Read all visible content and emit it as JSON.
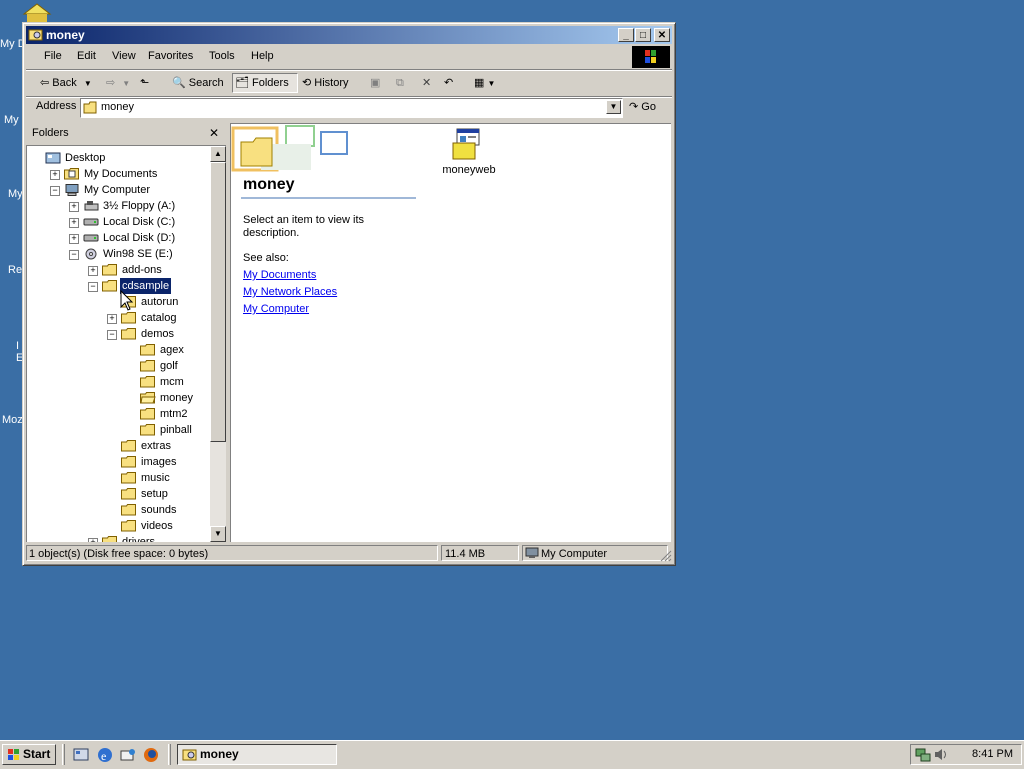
{
  "desktop": {
    "labels": [
      "My D",
      "My",
      "My",
      "Re",
      "I",
      "E",
      "Moz"
    ]
  },
  "window": {
    "title": "money",
    "controls": {
      "minimize": "_",
      "maximize": "□",
      "close": "✕"
    }
  },
  "menu": [
    "File",
    "Edit",
    "View",
    "Favorites",
    "Tools",
    "Help"
  ],
  "toolbar": {
    "back": "Back",
    "search": "Search",
    "folders": "Folders",
    "history": "History"
  },
  "address": {
    "label": "Address",
    "value": "money",
    "go": "Go"
  },
  "folders_pane": {
    "title": "Folders",
    "close": "✕",
    "tree": [
      {
        "label": "Desktop",
        "level": 0,
        "expander": "",
        "icon": "desktop-icon"
      },
      {
        "label": "My Documents",
        "level": 1,
        "expander": "+",
        "icon": "my-documents-icon"
      },
      {
        "label": "My Computer",
        "level": 1,
        "expander": "−",
        "icon": "my-computer-icon"
      },
      {
        "label": "3½ Floppy (A:)",
        "level": 2,
        "expander": "+",
        "icon": "floppy-icon"
      },
      {
        "label": "Local Disk (C:)",
        "level": 2,
        "expander": "+",
        "icon": "disk-icon"
      },
      {
        "label": "Local Disk (D:)",
        "level": 2,
        "expander": "+",
        "icon": "disk-icon"
      },
      {
        "label": "Win98 SE (E:)",
        "level": 2,
        "expander": "−",
        "icon": "cd-icon"
      },
      {
        "label": "add-ons",
        "level": 3,
        "expander": "+",
        "icon": "folder-icon"
      },
      {
        "label": "cdsample",
        "level": 3,
        "expander": "−",
        "icon": "folder-icon",
        "selected": true
      },
      {
        "label": "autorun",
        "level": 4,
        "expander": "",
        "icon": "folder-icon"
      },
      {
        "label": "catalog",
        "level": 4,
        "expander": "+",
        "icon": "folder-icon"
      },
      {
        "label": "demos",
        "level": 4,
        "expander": "−",
        "icon": "folder-icon"
      },
      {
        "label": "agex",
        "level": 5,
        "expander": "",
        "icon": "folder-icon"
      },
      {
        "label": "golf",
        "level": 5,
        "expander": "",
        "icon": "folder-icon"
      },
      {
        "label": "mcm",
        "level": 5,
        "expander": "",
        "icon": "folder-icon"
      },
      {
        "label": "money",
        "level": 5,
        "expander": "",
        "icon": "open-folder-icon"
      },
      {
        "label": "mtm2",
        "level": 5,
        "expander": "",
        "icon": "folder-icon"
      },
      {
        "label": "pinball",
        "level": 5,
        "expander": "",
        "icon": "folder-icon"
      },
      {
        "label": "extras",
        "level": 4,
        "expander": "",
        "icon": "folder-icon"
      },
      {
        "label": "images",
        "level": 4,
        "expander": "",
        "icon": "folder-icon"
      },
      {
        "label": "music",
        "level": 4,
        "expander": "",
        "icon": "folder-icon"
      },
      {
        "label": "setup",
        "level": 4,
        "expander": "",
        "icon": "folder-icon"
      },
      {
        "label": "sounds",
        "level": 4,
        "expander": "",
        "icon": "folder-icon"
      },
      {
        "label": "videos",
        "level": 4,
        "expander": "",
        "icon": "folder-icon"
      },
      {
        "label": "drivers",
        "level": 3,
        "expander": "+",
        "icon": "folder-icon"
      }
    ]
  },
  "content": {
    "folder_title": "money",
    "description": "Select an item to view its description.",
    "see_also_label": "See also:",
    "links": [
      "My Documents",
      "My Network Places",
      "My Computer"
    ],
    "files": [
      {
        "name": "moneyweb",
        "icon": "web-document-icon"
      }
    ]
  },
  "status": {
    "objects": "1 object(s) (Disk free space: 0 bytes)",
    "size": "11.4 MB",
    "zone": "My Computer"
  },
  "taskbar": {
    "start": "Start",
    "task": "money",
    "clock": "8:41 PM"
  },
  "colors": {
    "desktop": "#3a6ea5",
    "title_active_start": "#0a246a",
    "title_active_end": "#a6caf0",
    "face": "#d4d0c8",
    "selection": "#0a246a",
    "link": "#0000ee"
  }
}
